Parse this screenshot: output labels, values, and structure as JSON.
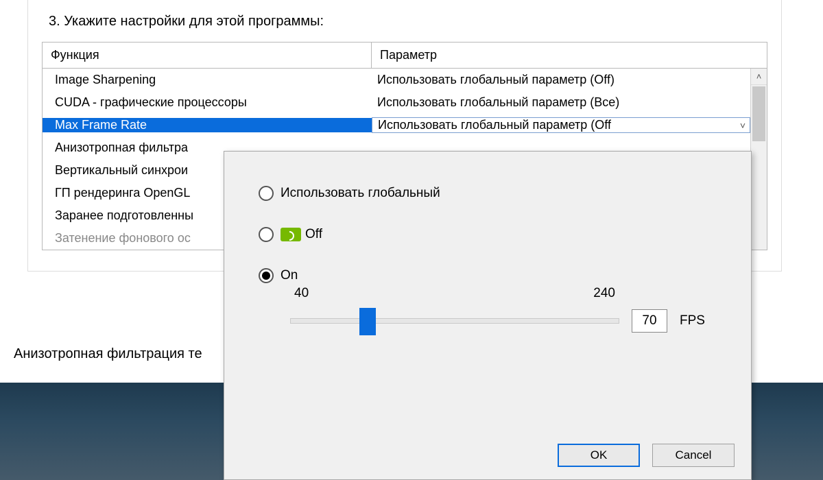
{
  "heading": "3. Укажите настройки для этой программы:",
  "table": {
    "header_func": "Функция",
    "header_param": "Параметр",
    "rows": [
      {
        "func": "Image Sharpening",
        "param": "Использовать глобальный параметр (Off)"
      },
      {
        "func": "CUDA - графические процессоры",
        "param": "Использовать глобальный параметр (Все)"
      },
      {
        "func": "Max Frame Rate",
        "param": "Использовать глобальный параметр (Off",
        "selected": true
      },
      {
        "func": "Анизотропная фильтра",
        "param": ""
      },
      {
        "func": "Вертикальный синхрои",
        "param": ""
      },
      {
        "func": "ГП рендеринга OpenGL",
        "param": ""
      },
      {
        "func": "Заранее подготовленны",
        "param": ""
      },
      {
        "func": "Затенение фонового ос",
        "param": "",
        "disabled": true
      }
    ]
  },
  "footer_text": "Анизотропная фильтрация те",
  "popup": {
    "opt_global": "Использовать глобальный",
    "opt_off": "Off",
    "opt_on": "On",
    "slider_min": "40",
    "slider_max": "240",
    "value": "70",
    "unit": "FPS",
    "ok": "OK",
    "cancel": "Cancel"
  }
}
